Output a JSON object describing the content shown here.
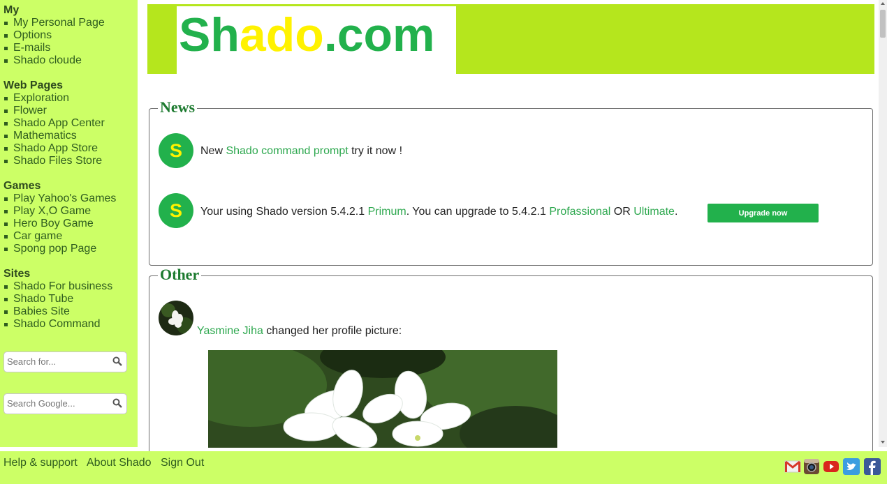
{
  "sidebar": {
    "groups": [
      {
        "heading": "My",
        "items": [
          "My Personal Page",
          "Options",
          "E-mails",
          "Shado cloude"
        ]
      },
      {
        "heading": "Web Pages",
        "items": [
          "Exploration",
          "Flower",
          "Shado App Center",
          "Mathematics",
          "Shado App Store",
          "Shado Files Store"
        ]
      },
      {
        "heading": "Games",
        "items": [
          "Play Yahoo's Games",
          "Play X,O Game",
          "Hero Boy Game",
          "Car game",
          "Spong pop Page"
        ]
      },
      {
        "heading": "Sites",
        "items": [
          "Shado For business",
          "Shado Tube",
          "Babies Site",
          "Shado Command"
        ]
      }
    ],
    "search1_placeholder": "Search for...",
    "search2_placeholder": "Search Google..."
  },
  "header": {
    "logo_parts": [
      "Sh",
      "ado",
      ".com"
    ]
  },
  "news": {
    "legend": "News",
    "icon_letter": "S",
    "item1": {
      "prefix": "New ",
      "link": "Shado command prompt",
      "suffix": " try it now !"
    },
    "item2": {
      "t1": "Your using Shado version 5.4.2.1 ",
      "link1": "Primum",
      "t2": ". You can upgrade to 5.4.2.1 ",
      "link2": "Profassional",
      "t3": " OR ",
      "link3": "Ultimate",
      "t4": "."
    },
    "upgrade_label": "Upgrade now"
  },
  "other": {
    "legend": "Other",
    "user_name": "Yasmine Jiha",
    "action_text": " changed her profile picture:"
  },
  "footer": {
    "links": [
      "Help & support",
      "About Shado",
      "Sign Out"
    ],
    "social_icons": [
      "gmail-icon",
      "instagram-icon",
      "youtube-icon",
      "twitter-icon",
      "facebook-icon"
    ]
  },
  "colors": {
    "sidebar_bg": "#ccff66",
    "header_bg": "#b5e61d",
    "brand_green": "#22b14c",
    "brand_yellow": "#fff200"
  }
}
